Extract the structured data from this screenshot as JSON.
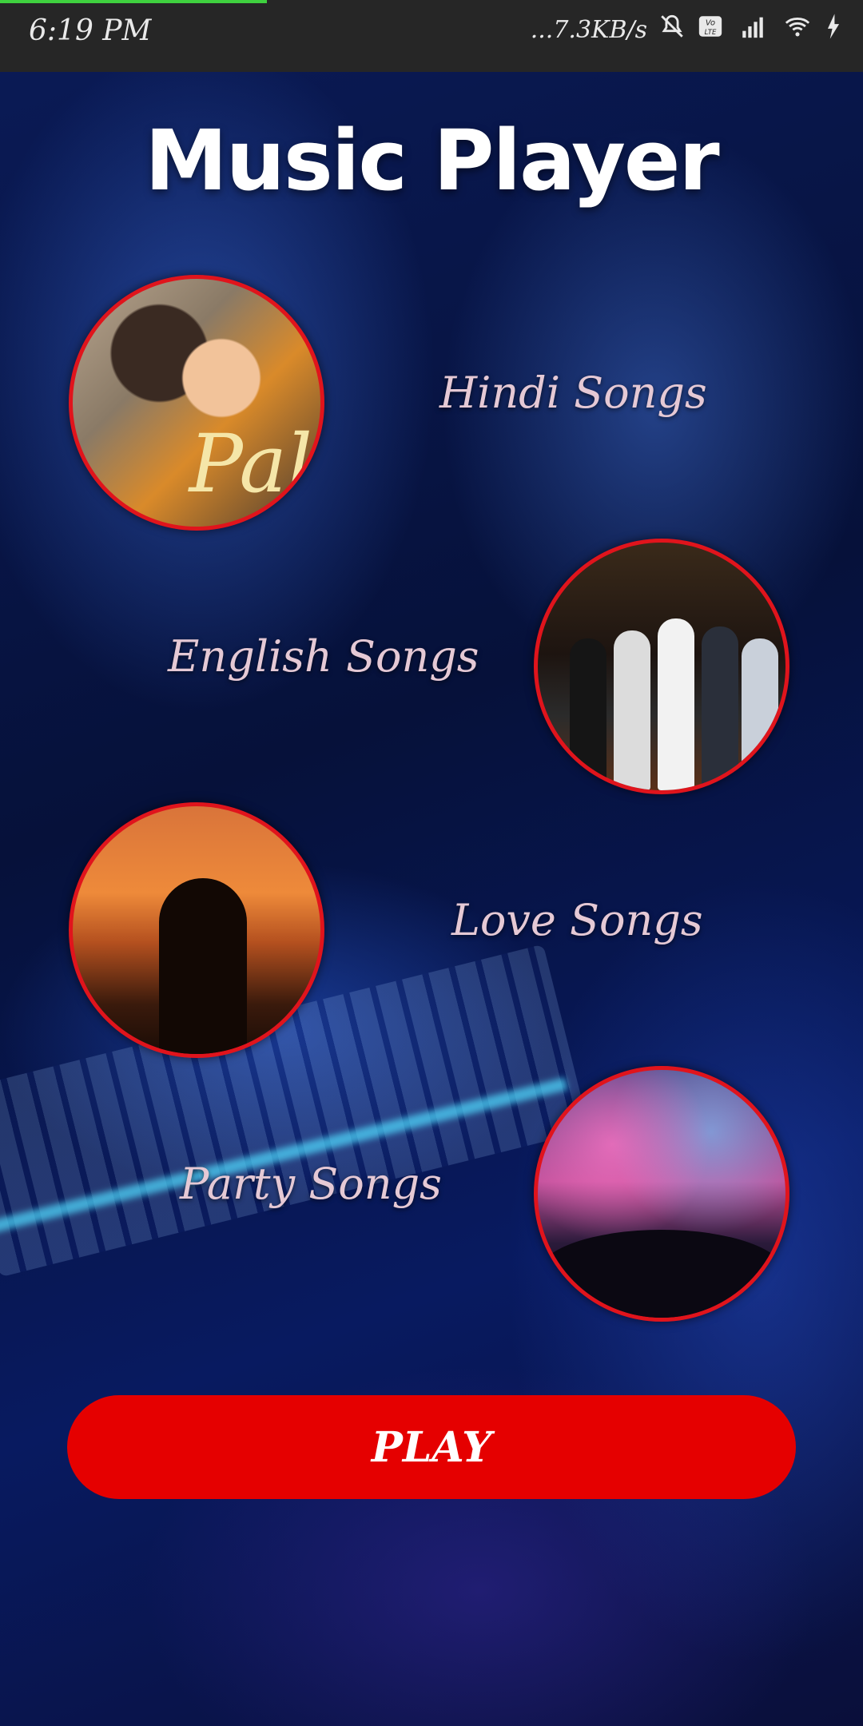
{
  "status_bar": {
    "time": "6:19 PM",
    "net_speed": "...7.3KB/s",
    "icons": [
      "mute-icon",
      "volte-icon",
      "signal-4g-icon",
      "wifi-icon",
      "charging-icon"
    ]
  },
  "app": {
    "title": "Music Player",
    "categories": [
      {
        "label": "Hindi Songs",
        "image": "hindi-songs-cover"
      },
      {
        "label": "English Songs",
        "image": "english-songs-cover"
      },
      {
        "label": "Love Songs",
        "image": "love-songs-cover"
      },
      {
        "label": "Party Songs",
        "image": "party-songs-cover"
      }
    ],
    "play_label": "PLAY",
    "hindi_cover_script": "Pal"
  },
  "colors": {
    "accent": "#e50000",
    "circle_border": "#e0141c",
    "label_text": "#e5c9d5",
    "status_bar_bg": "#262626"
  }
}
